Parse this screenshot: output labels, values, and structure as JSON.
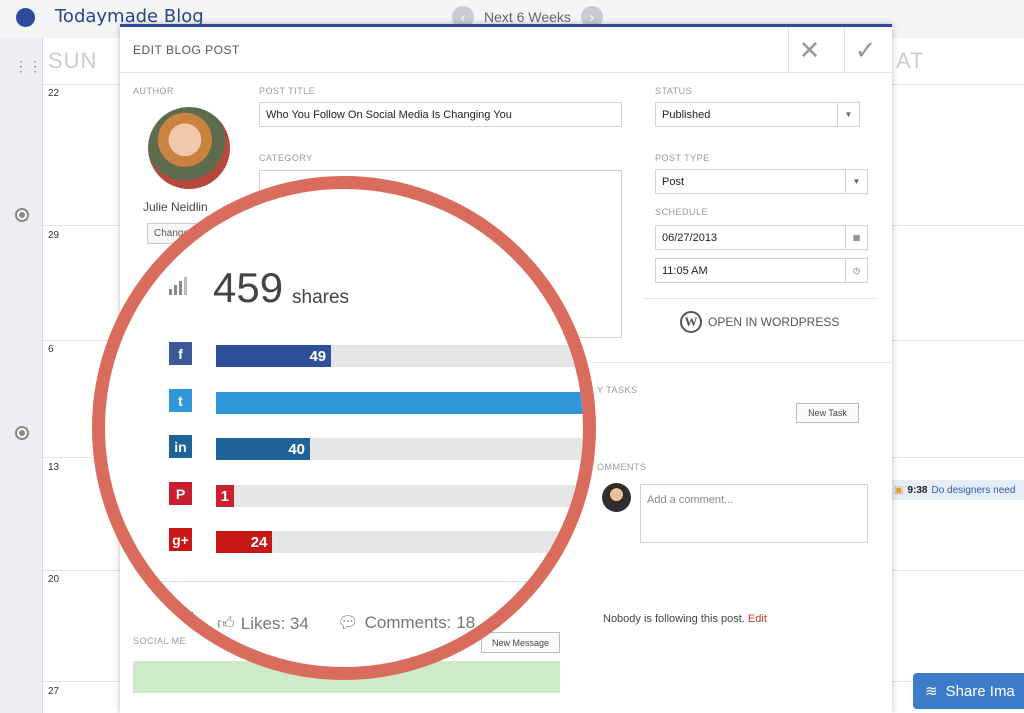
{
  "header": {
    "blog_title": "Todaymade Blog",
    "range_label": "Next 6 Weeks",
    "prev_glyph": "‹",
    "next_glyph": "›"
  },
  "calendar": {
    "day_headers": {
      "sun": "SUN",
      "sat": "AT"
    },
    "day_numbers": [
      "22",
      "29",
      "6",
      "13",
      "20",
      "27"
    ],
    "event": {
      "time": "9:38",
      "title": "Do designers need"
    }
  },
  "modal": {
    "title": "EDIT BLOG POST",
    "close_glyph": "✕",
    "save_glyph": "✓",
    "author_label": "AUTHOR",
    "author_name": "Julie Neidlin",
    "change_label": "Change",
    "post_title_label": "POST TITLE",
    "post_title_value": "Who You Follow On Social Media Is Changing You",
    "category_label": "CATEGORY",
    "status_label": "STATUS",
    "status_value": "Published",
    "post_type_label": "POST TYPE",
    "post_type_value": "Post",
    "schedule_label": "SCHEDULE",
    "schedule_date": "06/27/2013",
    "schedule_time": "11:05 AM",
    "wordpress_label": "OPEN IN WORDPRESS",
    "tasks_label": "Y TASKS",
    "new_task_label": "New Task",
    "comments_label": "OMMENTS",
    "comment_placeholder": "Add a comment...",
    "following_text": "Nobody is following this post.",
    "edit_link": "Edit",
    "social_label": "SOCIAL ME",
    "new_message_label": "New Message"
  },
  "magnifier": {
    "total_shares": "459",
    "shares_word": "shares",
    "networks": [
      {
        "name": "facebook",
        "icon": "f",
        "count": "49",
        "value": 49,
        "color": "#2f4f9a",
        "icon_color": "#3b5998"
      },
      {
        "name": "twitter",
        "icon": "t",
        "count": "",
        "value": 345,
        "color": "#2f96d9",
        "icon_color": "#2f96d9"
      },
      {
        "name": "linkedin",
        "icon": "in",
        "count": "40",
        "value": 40,
        "color": "#1f6399",
        "icon_color": "#1f6399"
      },
      {
        "name": "pinterest",
        "icon": "P",
        "count": "1",
        "value": 1,
        "color": "#c8202f",
        "icon_color": "#c8202f"
      },
      {
        "name": "googleplus",
        "icon": "g+",
        "count": "24",
        "value": 24,
        "color": "#c81717",
        "icon_color": "#c81717"
      }
    ],
    "likes_text": "Likes: 34",
    "comments_text": "Comments: 18"
  },
  "share_button": "Share Ima"
}
